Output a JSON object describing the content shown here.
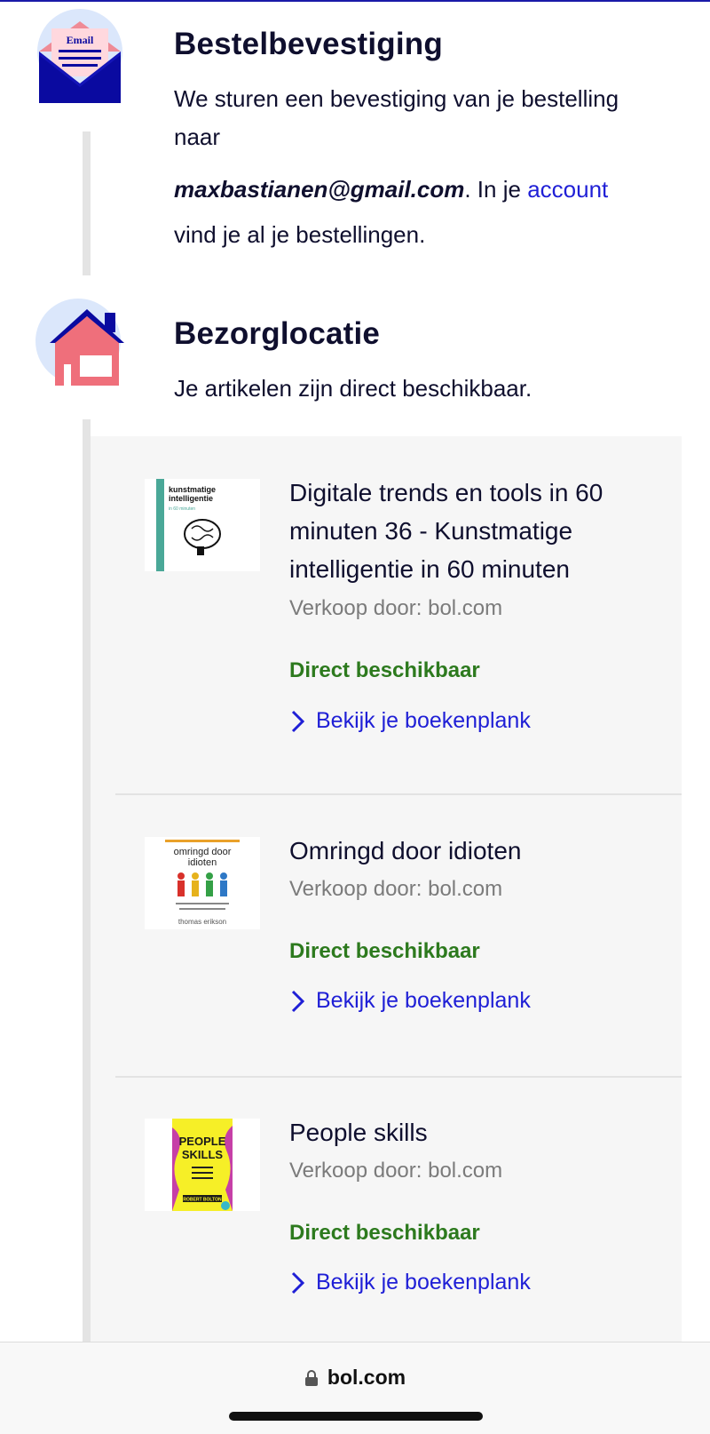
{
  "confirmation": {
    "icon_label": "Email",
    "title": "Bestelbevestiging",
    "text_intro": "We sturen een bevestiging van je bestelling naar",
    "email": "maxbastianen@gmail.com",
    "text_mid": ". In je ",
    "account_link": "account",
    "text_end": "vind je al je bestellingen."
  },
  "delivery": {
    "title": "Bezorglocatie",
    "subtitle": "Je artikelen zijn direct beschikbaar."
  },
  "items": [
    {
      "title": "Digitale trends en tools in 60 minuten 36 - Kunstmatige intelligentie in 60 minuten",
      "seller": "Verkoop door: bol.com",
      "availability": "Direct beschikbaar",
      "cta": "Bekijk je boekenplank",
      "cover_text": [
        "kunstmatige",
        "intelligentie",
        "in 60 minuten"
      ]
    },
    {
      "title": "Omringd door idioten",
      "seller": "Verkoop door: bol.com",
      "availability": "Direct beschikbaar",
      "cta": "Bekijk je boekenplank",
      "cover_text": [
        "omringd door",
        "idioten",
        "thomas erikson"
      ]
    },
    {
      "title": "People skills",
      "seller": "Verkoop door: bol.com",
      "availability": "Direct beschikbaar",
      "cta": "Bekijk je boekenplank",
      "cover_text": [
        "PEOPLE",
        "SKILLS",
        "ROBERT BOLTON"
      ]
    }
  ],
  "browser": {
    "url": "bol.com"
  },
  "colors": {
    "accent_blue": "#1f1fd6",
    "navy": "#0a0aa0",
    "available_green": "#2d7a1e",
    "house_pink": "#ef6f7b"
  }
}
